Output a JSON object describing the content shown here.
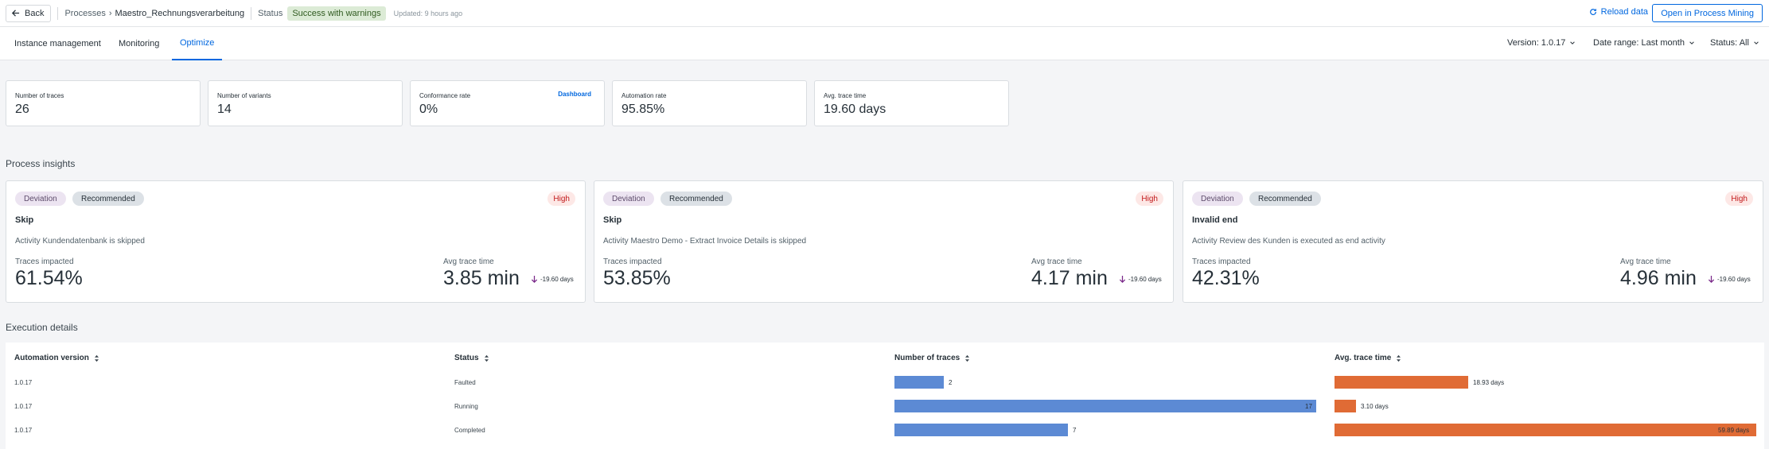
{
  "header": {
    "back_label": "Back",
    "breadcrumb_parent": "Processes",
    "breadcrumb_current": "Maestro_Rechnungsverarbeitung",
    "status_label": "Status",
    "status_value": "Success with warnings",
    "updated": "Updated: 9 hours ago",
    "reload_label": "Reload data",
    "open_pm_label": "Open in Process Mining"
  },
  "tabs": [
    {
      "label": "Instance management",
      "active": false
    },
    {
      "label": "Monitoring",
      "active": false
    },
    {
      "label": "Optimize",
      "active": true
    }
  ],
  "filters": {
    "version": "Version: 1.0.17",
    "date_range": "Date range: Last month",
    "status": "Status: All"
  },
  "kpis": [
    {
      "label": "Number of traces",
      "value": "26"
    },
    {
      "label": "Number of variants",
      "value": "14"
    },
    {
      "label": "Conformance rate",
      "value": "0%",
      "link": "Dashboard"
    },
    {
      "label": "Automation rate",
      "value": "95.85%"
    },
    {
      "label": "Avg. trace time",
      "value": "19.60 days"
    }
  ],
  "insights_title": "Process insights",
  "insights": [
    {
      "tag1": "Deviation",
      "tag2": "Recommended",
      "severity": "High",
      "name": "Skip",
      "description": "Activity Kundendatenbank is skipped",
      "traces_label": "Traces impacted",
      "traces_value": "61.54%",
      "avg_label": "Avg trace time",
      "avg_value": "3.85 min",
      "delta": "-19.60 days"
    },
    {
      "tag1": "Deviation",
      "tag2": "Recommended",
      "severity": "High",
      "name": "Skip",
      "description": "Activity Maestro Demo - Extract Invoice Details is skipped",
      "traces_label": "Traces impacted",
      "traces_value": "53.85%",
      "avg_label": "Avg trace time",
      "avg_value": "4.17 min",
      "delta": "-19.60 days"
    },
    {
      "tag1": "Deviation",
      "tag2": "Recommended",
      "severity": "High",
      "name": "Invalid end",
      "description": "Activity Review des Kunden  is executed as end activity",
      "traces_label": "Traces impacted",
      "traces_value": "42.31%",
      "avg_label": "Avg trace time",
      "avg_value": "4.96 min",
      "delta": "-19.60 days"
    }
  ],
  "execution_title": "Execution details",
  "table": {
    "columns": [
      "Automation version",
      "Status",
      "Number of traces",
      "Avg. trace time"
    ],
    "rows": [
      {
        "version": "1.0.17",
        "status": "Faulted",
        "traces": 2,
        "traces_label": "2",
        "avg_days": 18.93,
        "avg_label": "18.93 days"
      },
      {
        "version": "1.0.17",
        "status": "Running",
        "traces": 17,
        "traces_label": "17",
        "avg_days": 3.1,
        "avg_label": "3.10 days"
      },
      {
        "version": "1.0.17",
        "status": "Completed",
        "traces": 7,
        "traces_label": "7",
        "avg_days": 59.89,
        "avg_label": "59.89 days"
      }
    ]
  },
  "colors": {
    "accent": "#0067df",
    "traces_bar": "#5c8ad4",
    "time_bar": "#e06b35",
    "high": "#c2191b"
  }
}
